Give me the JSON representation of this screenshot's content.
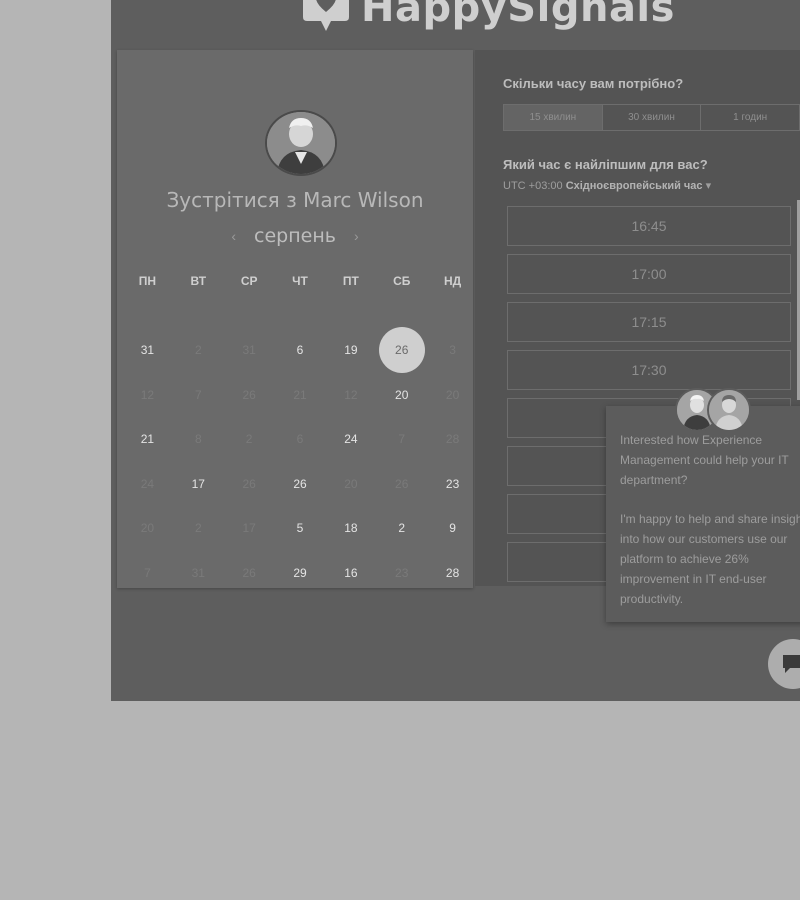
{
  "brand": {
    "logo_text": "HappySignals"
  },
  "booking": {
    "title": "Зустрітися з Marc Wilson",
    "month": "серпень"
  },
  "calendar": {
    "weekdays": [
      "ПН",
      "ВТ",
      "СР",
      "ЧТ",
      "ПТ",
      "СБ",
      "НД"
    ],
    "selected_day": "26",
    "rows": [
      [
        {
          "d": "31",
          "active": true
        },
        {
          "d": "2",
          "active": false
        },
        {
          "d": "31",
          "active": false
        },
        {
          "d": "6",
          "active": true
        },
        {
          "d": "19",
          "active": true
        },
        {
          "d": "26",
          "active": true,
          "selected": true
        },
        {
          "d": "3",
          "active": false
        }
      ],
      [
        {
          "d": "12",
          "active": false
        },
        {
          "d": "7",
          "active": false
        },
        {
          "d": "26",
          "active": false
        },
        {
          "d": "21",
          "active": false
        },
        {
          "d": "12",
          "active": false
        },
        {
          "d": "20",
          "active": true
        },
        {
          "d": "20",
          "active": false
        }
      ],
      [
        {
          "d": "21",
          "active": true
        },
        {
          "d": "8",
          "active": false
        },
        {
          "d": "2",
          "active": false
        },
        {
          "d": "6",
          "active": false
        },
        {
          "d": "24",
          "active": true
        },
        {
          "d": "7",
          "active": false
        },
        {
          "d": "28",
          "active": false
        }
      ],
      [
        {
          "d": "24",
          "active": false
        },
        {
          "d": "17",
          "active": true
        },
        {
          "d": "26",
          "active": false
        },
        {
          "d": "26",
          "active": true
        },
        {
          "d": "20",
          "active": false
        },
        {
          "d": "26",
          "active": false
        },
        {
          "d": "23",
          "active": true
        }
      ],
      [
        {
          "d": "20",
          "active": false
        },
        {
          "d": "2",
          "active": false
        },
        {
          "d": "17",
          "active": false
        },
        {
          "d": "5",
          "active": true
        },
        {
          "d": "18",
          "active": true
        },
        {
          "d": "2",
          "active": true
        },
        {
          "d": "9",
          "active": true
        }
      ],
      [
        {
          "d": "7",
          "active": false
        },
        {
          "d": "31",
          "active": false
        },
        {
          "d": "26",
          "active": false
        },
        {
          "d": "29",
          "active": true
        },
        {
          "d": "16",
          "active": true
        },
        {
          "d": "23",
          "active": false
        },
        {
          "d": "28",
          "active": true
        }
      ]
    ]
  },
  "duration": {
    "question": "Скільки часу вам потрібно?",
    "options": [
      "15 хвилин",
      "30 хвилин",
      "1 годин"
    ],
    "selected_index": 0
  },
  "time": {
    "question": "Який час є найліпшим для вас?",
    "tz_offset": "UTC +03:00",
    "tz_name": "Східноєвропейський час",
    "slots": [
      "16:45",
      "17:00",
      "17:15",
      "17:30",
      "",
      "",
      "",
      ""
    ]
  },
  "popup": {
    "paragraph1": "Interested how Experience Management could help your IT department?",
    "paragraph2": "I'm happy to help and share insight into how our customers use our platform to achieve 26% improvement in IT end-user productivity."
  },
  "colors": {
    "overlay": "#5e5e5e",
    "selected_day": "#cfcfcf",
    "page_bg": "#b5b5b5"
  }
}
